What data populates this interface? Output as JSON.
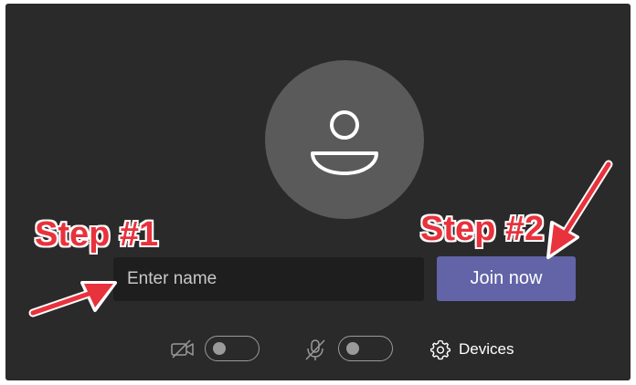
{
  "prejoin": {
    "avatar_icon": "person-icon",
    "name_input": {
      "placeholder": "Enter name",
      "value": ""
    },
    "join_button_label": "Join now",
    "controls": {
      "camera": {
        "icon": "camera-off-icon",
        "state": "off"
      },
      "microphone": {
        "icon": "mic-off-icon",
        "state": "off"
      },
      "devices": {
        "icon": "gear-icon",
        "label": "Devices"
      }
    }
  },
  "annotations": {
    "step1_label": "Step #1",
    "step2_label": "Step #2",
    "arrow_color": "#e8323c"
  },
  "colors": {
    "background": "#2a2a2a",
    "accent": "#6264a7",
    "avatar": "#5a5a5a"
  }
}
